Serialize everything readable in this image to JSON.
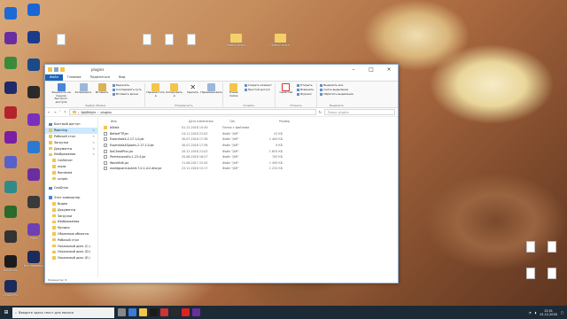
{
  "desktop_icons_left": [
    {
      "label": "",
      "color": "#1b6ad6"
    },
    {
      "label": "",
      "color": "#6a2ea0"
    },
    {
      "label": "",
      "color": "#3a8a3a"
    },
    {
      "label": "",
      "color": "#1e2a6a"
    },
    {
      "label": "",
      "color": "#b5232a"
    },
    {
      "label": "",
      "color": "#7a1fa3"
    },
    {
      "label": "",
      "color": "#5860c9"
    },
    {
      "label": "",
      "color": "#2f8a8a"
    },
    {
      "label": "",
      "color": "#2a6a2a"
    },
    {
      "label": "",
      "color": "#333333"
    },
    {
      "label": "Bandicam",
      "color": "#1b1b1b"
    },
    {
      "label": "VEGAS Pro",
      "color": "#1a2b5c"
    }
  ],
  "desktop_icons_left2": [
    {
      "label": "",
      "color": "#1a66d6"
    },
    {
      "label": "",
      "color": "#1c3b8a"
    },
    {
      "label": "",
      "color": "#1b4a8a"
    },
    {
      "label": "",
      "color": "#2a2a2a"
    },
    {
      "label": "",
      "color": "#7b2fbf"
    },
    {
      "label": "",
      "color": "#2a7ad1"
    },
    {
      "label": "",
      "color": "#6a2ea0"
    },
    {
      "label": "",
      "color": "#3a3a3a"
    },
    {
      "label": "Viber",
      "color": "#6f3fb4"
    },
    {
      "label": "Без названия",
      "color": "#1a2b5c"
    }
  ],
  "desktop_top_labels": [
    "",
    "Новая папка",
    "Новая папка"
  ],
  "window": {
    "title": "plugins",
    "tabs": [
      "Файл",
      "Главная",
      "Поделиться",
      "Вид"
    ],
    "ribbon": {
      "clipboard": {
        "pin": "Закрепить на панели быстрого доступа",
        "copy": "Копировать",
        "paste": "Вставить",
        "cut": "Вырезать",
        "copy_path": "Скопировать путь",
        "paste_shortcut": "Вставить ярлык",
        "group": "Буфер обмена"
      },
      "organize": {
        "move": "Переместить в",
        "copy_to": "Копировать в",
        "delete": "Удалить",
        "rename": "Переименовать",
        "group": "Упорядочить"
      },
      "new": {
        "folder": "Новая папка",
        "new_item": "Создать элемент",
        "easy_access": "Простой доступ",
        "group": "Создать"
      },
      "open": {
        "props": "Свойства",
        "open": "Открыть",
        "edit": "Изменить",
        "history": "Журнал",
        "group": "Открыть"
      },
      "select": {
        "all": "Выделить все",
        "none": "Снять выделение",
        "invert": "Обратить выделение",
        "group": "Выделить"
      }
    },
    "address": {
      "path": [
        "fghjfhfghr",
        "plugins"
      ],
      "search_placeholder": "Поиск: plugins"
    },
    "nav": [
      {
        "label": "Быстрый доступ",
        "type": "header"
      },
      {
        "label": "Roaming",
        "type": "pin",
        "selected": true
      },
      {
        "label": "Рабочий стол",
        "type": "pin"
      },
      {
        "label": "Загрузки",
        "type": "pin"
      },
      {
        "label": "Документы",
        "type": "pin"
      },
      {
        "label": "Изображения",
        "type": "pin"
      },
      {
        "label": "CatServer",
        "type": "sub"
      },
      {
        "label": "mods",
        "type": "sub"
      },
      {
        "label": "Rendered",
        "type": "sub"
      },
      {
        "label": "scripts",
        "type": "sub"
      },
      {
        "label": "OneDrive",
        "type": "header"
      },
      {
        "label": "Этот компьютер",
        "type": "header"
      },
      {
        "label": "Видео",
        "type": "sub"
      },
      {
        "label": "Документы",
        "type": "sub"
      },
      {
        "label": "Загрузки",
        "type": "sub"
      },
      {
        "label": "Изображения",
        "type": "sub"
      },
      {
        "label": "Музыка",
        "type": "sub"
      },
      {
        "label": "Объемные объекты",
        "type": "sub"
      },
      {
        "label": "Рабочий стол",
        "type": "sub"
      },
      {
        "label": "Локальный диск (C:)",
        "type": "sub"
      },
      {
        "label": "Локальный диск (D:)",
        "type": "sub"
      },
      {
        "label": "Локальный диск (E:)",
        "type": "sub"
      }
    ],
    "columns": [
      "Имя",
      "Дата изменения",
      "Тип",
      "Размер"
    ],
    "files": [
      {
        "name": "bStats",
        "date": "01.12.2018 15:49",
        "type": "Папка с файлами",
        "size": "",
        "kind": "folder"
      },
      {
        "name": "BetterFTP.jar",
        "date": "24.11.2018 21:02",
        "type": "Файл \"JAR\"",
        "size": "41 КБ",
        "kind": "jar"
      },
      {
        "name": "EssentialsX-2.17.1.0.jar",
        "date": "30.07.2018 17:38",
        "type": "Файл \"JAR\"",
        "size": "1 404 КБ",
        "kind": "jar"
      },
      {
        "name": "EssentialsXSpawn-2.17.1.0.jar",
        "date": "30.07.2018 17:38",
        "type": "Файл \"JAR\"",
        "size": "9 КБ",
        "kind": "jar"
      },
      {
        "name": "NoCheatPlus.jar",
        "date": "20.11.2018 21:03",
        "type": "Файл \"JAR\"",
        "size": "1 655 КБ",
        "kind": "jar"
      },
      {
        "name": "PermissionsEx-1.23.4.jar",
        "date": "20.06.2018 16:27",
        "type": "Файл \"JAR\"",
        "size": "705 КБ",
        "kind": "jar"
      },
      {
        "name": "WorldEdit.jar",
        "date": "11.06.2017 22:45",
        "type": "Файл \"JAR\"",
        "size": "1 495 КБ",
        "kind": "jar"
      },
      {
        "name": "worldguard-bukkit-7.0.1-rc2-dist.jar",
        "date": "23.11.2018 13:17",
        "type": "Файл \"JAR\"",
        "size": "1 232 КБ",
        "kind": "jar"
      }
    ],
    "status": "Элементов: 8"
  },
  "taskbar": {
    "search_placeholder": "Введите здесь текст для поиска",
    "time": "15:51",
    "date": "01.12.2018",
    "apps_colors": [
      "#888888",
      "#3a7bd5",
      "#f3c54a",
      "#1b1b1b",
      "#c33",
      "#2a2a2a",
      "#d22",
      "#6a2ea0"
    ]
  }
}
